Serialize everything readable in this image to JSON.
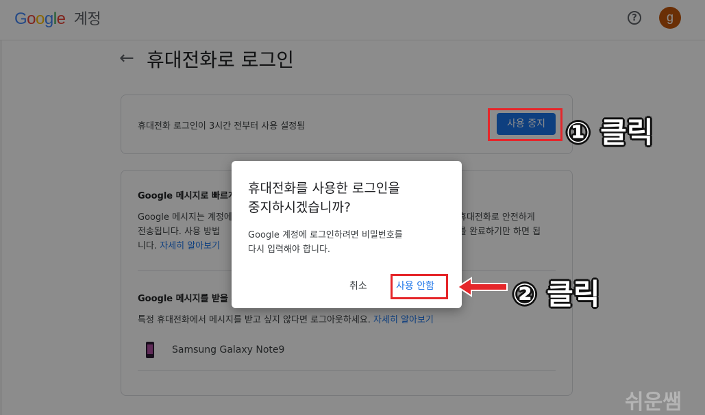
{
  "header": {
    "logo_parts": [
      "G",
      "o",
      "o",
      "g",
      "l",
      "e"
    ],
    "account_label": "계정",
    "avatar_letter": "g",
    "help_icon": "help-circle-icon"
  },
  "page": {
    "back_icon": "arrow-left-icon",
    "title": "휴대전화로 로그인"
  },
  "status_card": {
    "status_text": "휴대전화 로그인이 3시간 전부터 사용 설정됨",
    "stop_label": "사용 중지"
  },
  "info_card": {
    "section1_title": "Google 메시지로 빠르게 로그인",
    "section1_body_start": "Google 메시지는 계정에 로그인할 때 휴대전화로 전송됩니다",
    "section1_body_end": "휴대전화로 안전하게",
    "section1_line2_start": "전송됩니다. 사용 방법",
    "section1_line2_end": "를 완료하기만 하면 됩",
    "section1_line3": "니다.",
    "section1_link": "자세히 알아보기",
    "section2_title": "Google 메시지를 받을 휴대전화",
    "section2_body": "특정 휴대전화에서 메시지를 받고 싶지 않다면 로그아웃하세요.",
    "section2_link": "자세히 알아보기",
    "device_name": "Samsung Galaxy Note9"
  },
  "dialog": {
    "title_line1": "휴대전화를 사용한 로그인을",
    "title_line2": "중지하시겠습니까?",
    "body_line1": "Google 계정에 로그인하려면 비밀번호를",
    "body_line2": "다시 입력해야 합니다.",
    "cancel_label": "취소",
    "confirm_label": "사용 안함"
  },
  "annotations": {
    "step1": "① 클릭",
    "step2": "② 클릭",
    "watermark": "쉬운쌤",
    "highlight_color": "#e5262a"
  }
}
